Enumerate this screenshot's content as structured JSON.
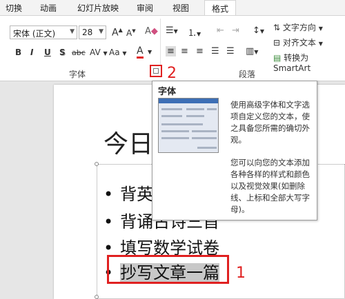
{
  "ribbon_tabs": [
    "切换",
    "动画",
    "幻灯片放映",
    "审阅",
    "视图",
    "格式"
  ],
  "font": {
    "name": "宋体 (正文)",
    "size": "28",
    "grow_label": "A",
    "shrink_label": "A",
    "clear_label": "A",
    "bold": "B",
    "italic": "I",
    "underline": "U",
    "shadow": "S",
    "strike": "abc",
    "spacing": "AV",
    "case": "Aa",
    "color": "A",
    "group_label": "字体"
  },
  "paragraph": {
    "text_direction": "文字方向",
    "align_text": "对齐文本",
    "convert_smartart": "转换为 SmartArt",
    "group_label": "段落"
  },
  "annotations": {
    "num1": "1",
    "num2": "2"
  },
  "slide": {
    "title": "今日",
    "bullets": [
      "背英",
      "背诵古诗三首",
      "填写数学试卷",
      "抄写文章一篇"
    ]
  },
  "tooltip": {
    "title": "字体",
    "para1": "使用高级字体和文字选项自定义您的文本，使之具备您所需的确切外观。",
    "para2": "您可以向您的文本添加各种各样的样式和颜色以及视觉效果(如删除线、上标和全部大写字母)。"
  },
  "colors": {
    "highlight_red": "#e02020",
    "font_color_bar": "#e02020"
  }
}
